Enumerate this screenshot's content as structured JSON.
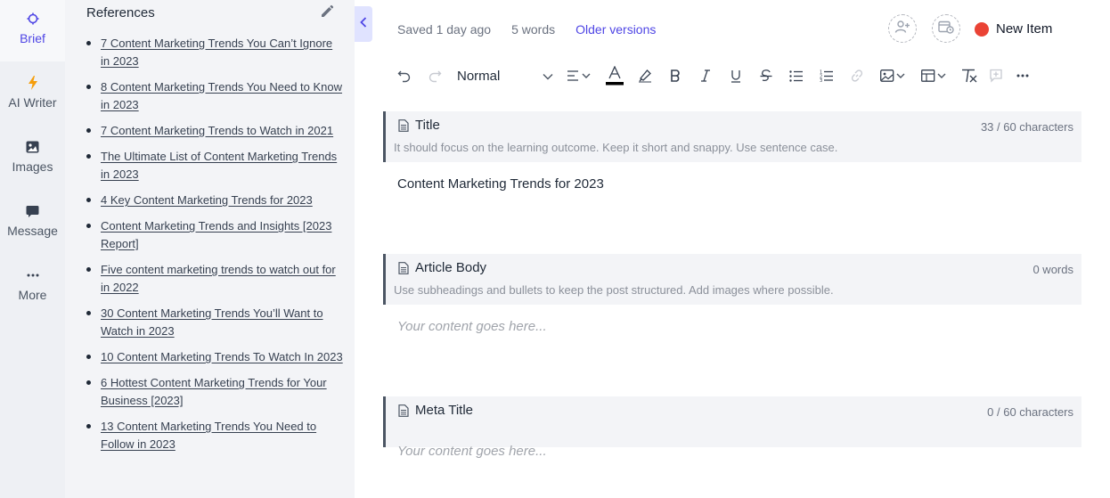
{
  "rail": {
    "items": [
      {
        "label": "Brief",
        "icon": "crosshair-icon"
      },
      {
        "label": "AI Writer",
        "icon": "lightning-icon"
      },
      {
        "label": "Images",
        "icon": "image-icon"
      },
      {
        "label": "Message",
        "icon": "message-icon"
      },
      {
        "label": "More",
        "icon": "ellipsis-icon"
      }
    ],
    "active": "Brief",
    "accent": "#4f46e5"
  },
  "references": {
    "title": "References",
    "items": [
      "7 Content Marketing Trends You Can’t Ignore in 2023",
      "8 Content Marketing Trends You Need to Know in 2023",
      "7 Content Marketing Trends to Watch in 2021",
      "The Ultimate List of Content Marketing Trends in 2023",
      "4 Key Content Marketing Trends for 2023",
      "Content Marketing Trends and Insights [2023 Report]",
      "Five content marketing trends to watch out for in 2022",
      "30 Content Marketing Trends You’ll Want to Watch in 2023",
      "10 Content Marketing Trends To Watch In 2023",
      "6 Hottest Content Marketing Trends for Your Business [2023]",
      "13 Content Marketing Trends You Need to Follow in 2023"
    ]
  },
  "status": {
    "saved": "Saved 1 day ago",
    "words": "5 words",
    "versions_link": "Older versions"
  },
  "header": {
    "new_item_label": "New Item",
    "status_color": "#ea4335"
  },
  "toolbar": {
    "paragraph_style": "Normal"
  },
  "sections": {
    "title": {
      "name": "Title",
      "count": "33 / 60 characters",
      "hint": "It should focus on the learning outcome. Keep it short and snappy. Use sentence case.",
      "content": "Content Marketing Trends for 2023"
    },
    "body": {
      "name": "Article Body",
      "count": "0 words",
      "hint": "Use subheadings and bullets to keep the post structured. Add images where possible.",
      "placeholder": "Your content goes here..."
    },
    "meta": {
      "name": "Meta Title",
      "count": "0 / 60 characters",
      "placeholder": "Your content goes here..."
    }
  }
}
